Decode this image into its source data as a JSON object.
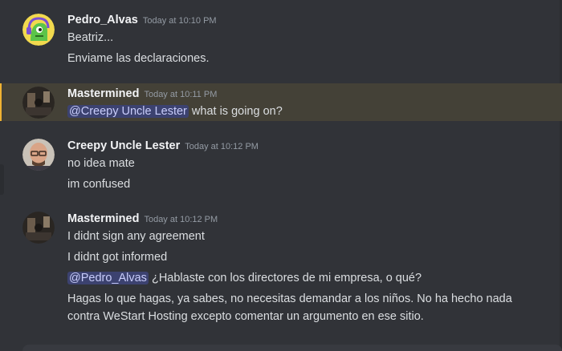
{
  "top_fragment": "• ·",
  "messages": [
    {
      "author": "Pedro_Alvas",
      "timestamp": "Today at 10:10 PM",
      "avatar_icon": "green-dino-headset-avatar",
      "lines": [
        "Beatriz...",
        "Enviame las declaraciones."
      ]
    },
    {
      "author": "Mastermined",
      "timestamp": "Today at 10:11 PM",
      "avatar_icon": "dark-room-avatar",
      "mention": "@Creepy Uncle Lester",
      "text": "what is going on?"
    },
    {
      "author": "Creepy Uncle Lester",
      "timestamp": "Today at 10:12 PM",
      "avatar_icon": "bald-man-avatar",
      "lines": [
        "no idea mate",
        "im confused"
      ]
    },
    {
      "author": "Mastermined",
      "timestamp": "Today at 10:12 PM",
      "avatar_icon": "dark-room-avatar",
      "lines": [
        "I didnt sign any agreement",
        "I didnt got informed"
      ],
      "mention": "@Pedro_Alvas",
      "mention_text": "¿Hablaste con los directores de mi empresa, o qué?",
      "paragraph": [
        "Hagas lo que hagas, ya sabes, no necesitas demandar a los niños. No ha hecho nada",
        "contra WeStart Hosting excepto comentar un argumento en ese sitio."
      ]
    }
  ],
  "colors": {
    "background": "#313338",
    "highlight_bg": "#444137",
    "highlight_border": "#f0b232",
    "mention_bg": "#3c4270",
    "mention_text": "#c9cdfb"
  }
}
